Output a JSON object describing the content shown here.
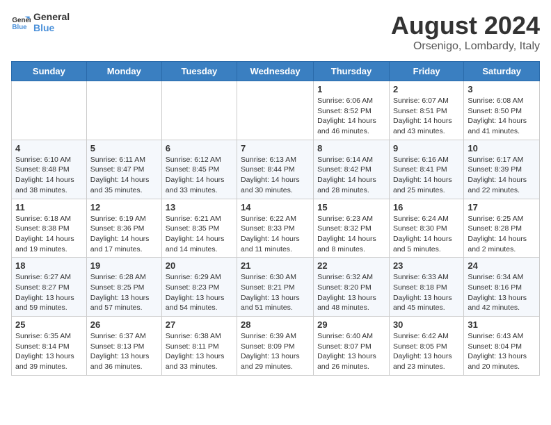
{
  "logo": {
    "line1": "General",
    "line2": "Blue"
  },
  "title": "August 2024",
  "location": "Orsenigo, Lombardy, Italy",
  "days_header": [
    "Sunday",
    "Monday",
    "Tuesday",
    "Wednesday",
    "Thursday",
    "Friday",
    "Saturday"
  ],
  "weeks": [
    [
      {
        "day": "",
        "info": ""
      },
      {
        "day": "",
        "info": ""
      },
      {
        "day": "",
        "info": ""
      },
      {
        "day": "",
        "info": ""
      },
      {
        "day": "1",
        "info": "Sunrise: 6:06 AM\nSunset: 8:52 PM\nDaylight: 14 hours\nand 46 minutes."
      },
      {
        "day": "2",
        "info": "Sunrise: 6:07 AM\nSunset: 8:51 PM\nDaylight: 14 hours\nand 43 minutes."
      },
      {
        "day": "3",
        "info": "Sunrise: 6:08 AM\nSunset: 8:50 PM\nDaylight: 14 hours\nand 41 minutes."
      }
    ],
    [
      {
        "day": "4",
        "info": "Sunrise: 6:10 AM\nSunset: 8:48 PM\nDaylight: 14 hours\nand 38 minutes."
      },
      {
        "day": "5",
        "info": "Sunrise: 6:11 AM\nSunset: 8:47 PM\nDaylight: 14 hours\nand 35 minutes."
      },
      {
        "day": "6",
        "info": "Sunrise: 6:12 AM\nSunset: 8:45 PM\nDaylight: 14 hours\nand 33 minutes."
      },
      {
        "day": "7",
        "info": "Sunrise: 6:13 AM\nSunset: 8:44 PM\nDaylight: 14 hours\nand 30 minutes."
      },
      {
        "day": "8",
        "info": "Sunrise: 6:14 AM\nSunset: 8:42 PM\nDaylight: 14 hours\nand 28 minutes."
      },
      {
        "day": "9",
        "info": "Sunrise: 6:16 AM\nSunset: 8:41 PM\nDaylight: 14 hours\nand 25 minutes."
      },
      {
        "day": "10",
        "info": "Sunrise: 6:17 AM\nSunset: 8:39 PM\nDaylight: 14 hours\nand 22 minutes."
      }
    ],
    [
      {
        "day": "11",
        "info": "Sunrise: 6:18 AM\nSunset: 8:38 PM\nDaylight: 14 hours\nand 19 minutes."
      },
      {
        "day": "12",
        "info": "Sunrise: 6:19 AM\nSunset: 8:36 PM\nDaylight: 14 hours\nand 17 minutes."
      },
      {
        "day": "13",
        "info": "Sunrise: 6:21 AM\nSunset: 8:35 PM\nDaylight: 14 hours\nand 14 minutes."
      },
      {
        "day": "14",
        "info": "Sunrise: 6:22 AM\nSunset: 8:33 PM\nDaylight: 14 hours\nand 11 minutes."
      },
      {
        "day": "15",
        "info": "Sunrise: 6:23 AM\nSunset: 8:32 PM\nDaylight: 14 hours\nand 8 minutes."
      },
      {
        "day": "16",
        "info": "Sunrise: 6:24 AM\nSunset: 8:30 PM\nDaylight: 14 hours\nand 5 minutes."
      },
      {
        "day": "17",
        "info": "Sunrise: 6:25 AM\nSunset: 8:28 PM\nDaylight: 14 hours\nand 2 minutes."
      }
    ],
    [
      {
        "day": "18",
        "info": "Sunrise: 6:27 AM\nSunset: 8:27 PM\nDaylight: 13 hours\nand 59 minutes."
      },
      {
        "day": "19",
        "info": "Sunrise: 6:28 AM\nSunset: 8:25 PM\nDaylight: 13 hours\nand 57 minutes."
      },
      {
        "day": "20",
        "info": "Sunrise: 6:29 AM\nSunset: 8:23 PM\nDaylight: 13 hours\nand 54 minutes."
      },
      {
        "day": "21",
        "info": "Sunrise: 6:30 AM\nSunset: 8:21 PM\nDaylight: 13 hours\nand 51 minutes."
      },
      {
        "day": "22",
        "info": "Sunrise: 6:32 AM\nSunset: 8:20 PM\nDaylight: 13 hours\nand 48 minutes."
      },
      {
        "day": "23",
        "info": "Sunrise: 6:33 AM\nSunset: 8:18 PM\nDaylight: 13 hours\nand 45 minutes."
      },
      {
        "day": "24",
        "info": "Sunrise: 6:34 AM\nSunset: 8:16 PM\nDaylight: 13 hours\nand 42 minutes."
      }
    ],
    [
      {
        "day": "25",
        "info": "Sunrise: 6:35 AM\nSunset: 8:14 PM\nDaylight: 13 hours\nand 39 minutes."
      },
      {
        "day": "26",
        "info": "Sunrise: 6:37 AM\nSunset: 8:13 PM\nDaylight: 13 hours\nand 36 minutes."
      },
      {
        "day": "27",
        "info": "Sunrise: 6:38 AM\nSunset: 8:11 PM\nDaylight: 13 hours\nand 33 minutes."
      },
      {
        "day": "28",
        "info": "Sunrise: 6:39 AM\nSunset: 8:09 PM\nDaylight: 13 hours\nand 29 minutes."
      },
      {
        "day": "29",
        "info": "Sunrise: 6:40 AM\nSunset: 8:07 PM\nDaylight: 13 hours\nand 26 minutes."
      },
      {
        "day": "30",
        "info": "Sunrise: 6:42 AM\nSunset: 8:05 PM\nDaylight: 13 hours\nand 23 minutes."
      },
      {
        "day": "31",
        "info": "Sunrise: 6:43 AM\nSunset: 8:04 PM\nDaylight: 13 hours\nand 20 minutes."
      }
    ]
  ]
}
